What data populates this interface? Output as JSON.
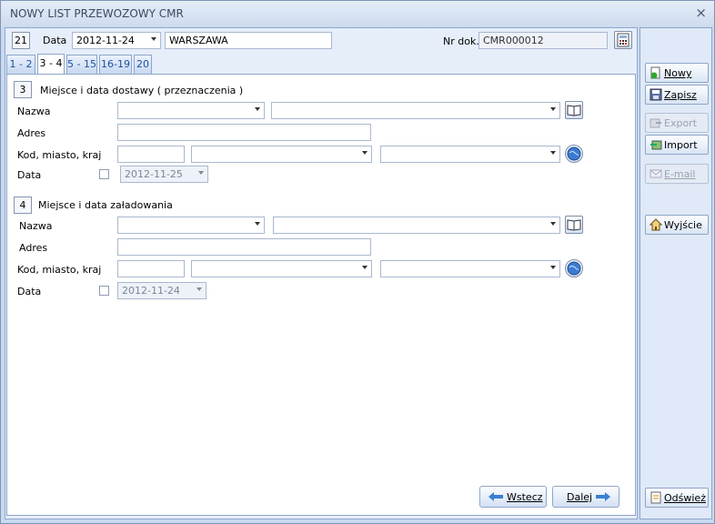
{
  "window": {
    "title": "NOWY LIST PRZEWOZOWY CMR",
    "close_glyph": "×"
  },
  "header": {
    "number": "21",
    "date_label": "Data",
    "date_value": "2012-11-24",
    "place_value": "WARSZAWA",
    "docno_label": "Nr dok.",
    "docno_value": "CMR000012"
  },
  "tabs": [
    {
      "label": "1 - 2"
    },
    {
      "label": "3 - 4"
    },
    {
      "label": "5 - 15"
    },
    {
      "label": "16-19"
    },
    {
      "label": "20"
    }
  ],
  "active_tab": "3 - 4",
  "section3": {
    "number": "3",
    "title": "Miejsce i data dostawy ( przeznaczenia )",
    "name_label": "Nazwa",
    "address_label": "Adres",
    "city_label": "Kod, miasto, kraj",
    "date_label": "Data",
    "date_value": "2012-11-25"
  },
  "section4": {
    "number": "4",
    "title": "Miejsce i data załadowania",
    "name_label": "Nazwa",
    "address_label": "Adres",
    "city_label": "Kod, miasto, kraj",
    "date_label": "Data",
    "date_value": "2012-11-24"
  },
  "nav": {
    "back_label": "Wstecz",
    "next_label": "Dalej"
  },
  "sidebar": {
    "new_label": "Nowy",
    "save_label": "Zapisz",
    "export_label": "Export",
    "import_label": "Import",
    "email_label": "E-mail",
    "exit_label": "Wyjście",
    "refresh_label": "Odśwież"
  }
}
